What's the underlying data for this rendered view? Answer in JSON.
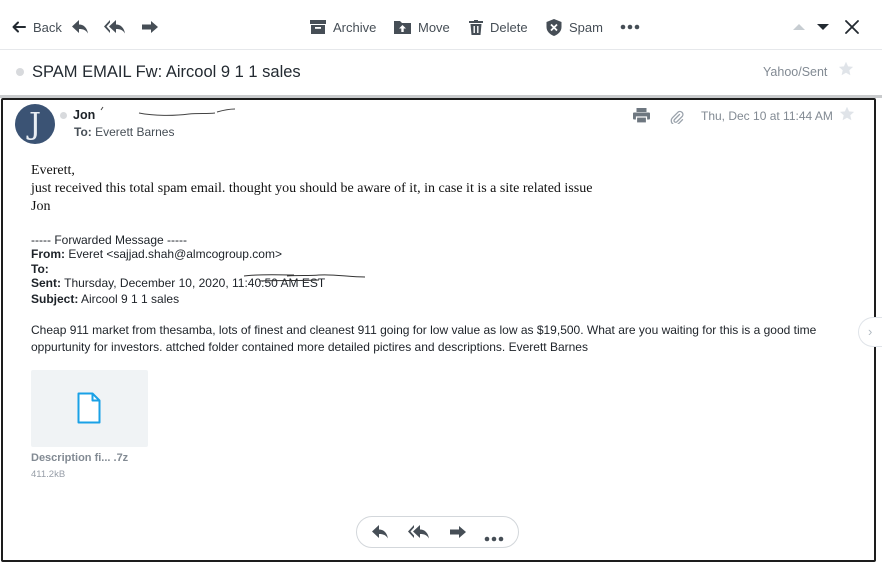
{
  "toolbar": {
    "back_label": "Back",
    "archive_label": "Archive",
    "move_label": "Move",
    "delete_label": "Delete",
    "spam_label": "Spam"
  },
  "subject": {
    "title": "SPAM EMAIL Fw: Aircool  9  1 1 sales",
    "folder": "Yahoo/Sent"
  },
  "message": {
    "avatar_letter": "J",
    "sender": "Jon",
    "to_label": "To:",
    "to_name": "Everett Barnes",
    "date": "Thu, Dec 10 at 11:44 AM",
    "greeting": "Everett,",
    "body_line": "just received this total spam email. thought you should be aware of it, in case it is a site related issue",
    "signoff": "Jon",
    "forward": {
      "header": "----- Forwarded Message -----",
      "from_label": "From:",
      "from_value": "Everet <sajjad.shah@almcogroup.com>",
      "to_label": "To:",
      "sent_label": "Sent:",
      "sent_value": "Thursday, December 10, 2020, 11:40:50 AM EST",
      "subject_label": "Subject:",
      "subject_value": "Aircool  9  1 1 sales"
    },
    "forwarded_body": "Cheap 911 market from thesamba, lots of finest and cleanest 911 going for low value as low as $19,500. What are you waiting for this is a good time oppurtunity for investors. attched folder contained more detailed pictires and descriptions.  Everett Barnes",
    "attachment": {
      "name": "Description fi... .7z",
      "size": "411.2kB"
    }
  },
  "icons": {
    "reply": "reply-icon",
    "reply_all": "reply-all-icon",
    "forward": "forward-icon",
    "more": "more-icon",
    "file": "file-icon"
  },
  "colors": {
    "accent": "#0f69ff",
    "file_icon": "#1aa1e6",
    "text": "#232a31",
    "muted": "#828a93"
  }
}
